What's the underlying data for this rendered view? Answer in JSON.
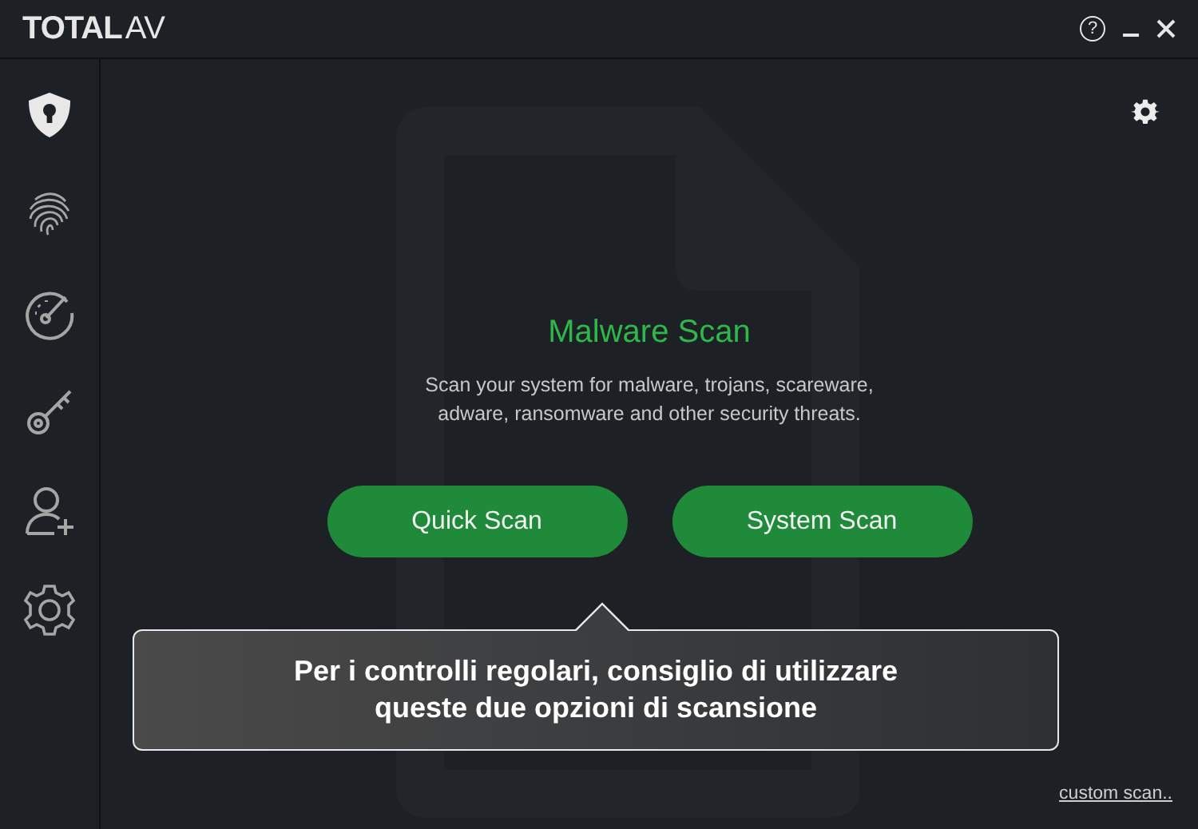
{
  "logo": {
    "strong": "TOTAL",
    "light": "AV"
  },
  "window_controls": {
    "help": "?"
  },
  "sidebar": {
    "items": [
      {
        "kind": "shield",
        "selected": true
      },
      {
        "kind": "fingerprint",
        "selected": false
      },
      {
        "kind": "speedometer",
        "selected": false
      },
      {
        "kind": "key",
        "selected": false
      },
      {
        "kind": "user-add",
        "selected": false
      },
      {
        "kind": "gear",
        "selected": false
      }
    ]
  },
  "main": {
    "title": "Malware Scan",
    "description": "Scan your system for malware, trojans, scareware, adware, ransomware and other security threats.",
    "buttons": [
      "Quick Scan",
      "System Scan"
    ],
    "link": "custom scan.."
  },
  "tooltip": {
    "lines": [
      "Per i controlli regolari, consiglio di utilizzare",
      "queste due opzioni di scansione"
    ]
  }
}
